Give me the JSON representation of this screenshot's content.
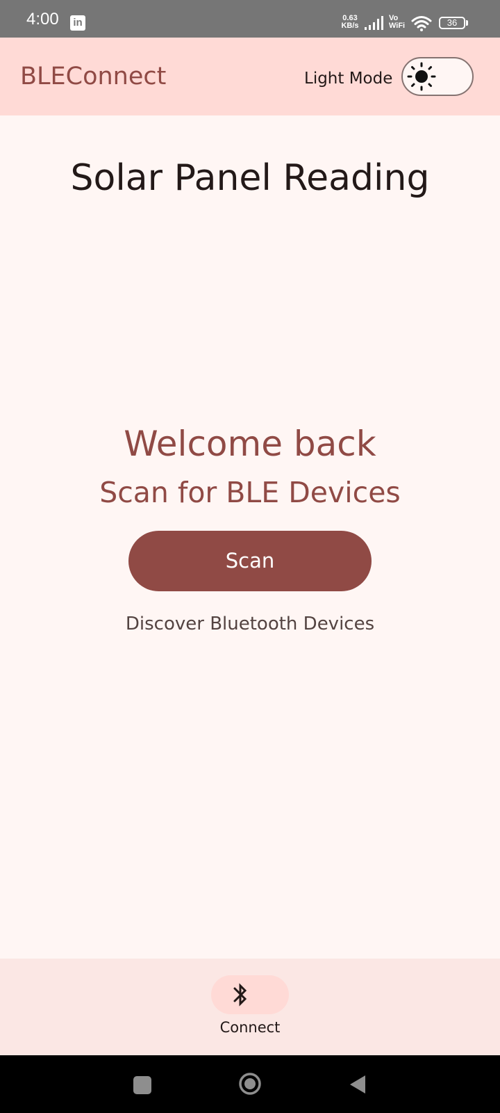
{
  "status_bar": {
    "time": "4:00",
    "app_icon_glyph": "in",
    "network_speed_value": "0.63",
    "network_speed_unit": "KB/s",
    "vowifi_top": "Vo",
    "vowifi_bottom": "WiFi",
    "battery_level": "36",
    "icons": [
      "linkedin-icon",
      "signal-icon",
      "wifi-icon",
      "battery-icon"
    ]
  },
  "app_bar": {
    "title": "BLEConnect",
    "mode_label": "Light Mode",
    "mode_switch_icon": "sun-icon",
    "mode_switch_on": false
  },
  "main": {
    "page_title": "Solar Panel Reading",
    "welcome_heading": "Welcome back",
    "welcome_subheading": "Scan for BLE Devices",
    "scan_button_label": "Scan",
    "scan_caption": "Discover Bluetooth Devices"
  },
  "bottom_nav": {
    "items": [
      {
        "label": "Connect",
        "icon": "bluetooth-icon",
        "selected": true
      }
    ]
  },
  "system_nav": {
    "buttons": [
      "recents-button",
      "home-button",
      "back-button"
    ]
  },
  "colors": {
    "primary": "#904a45",
    "app_bar_bg": "#ffdad6",
    "background": "#fff6f4",
    "nav_bg": "#fbe7e4",
    "on_surface": "#231918",
    "status_bar_bg": "#767676"
  }
}
